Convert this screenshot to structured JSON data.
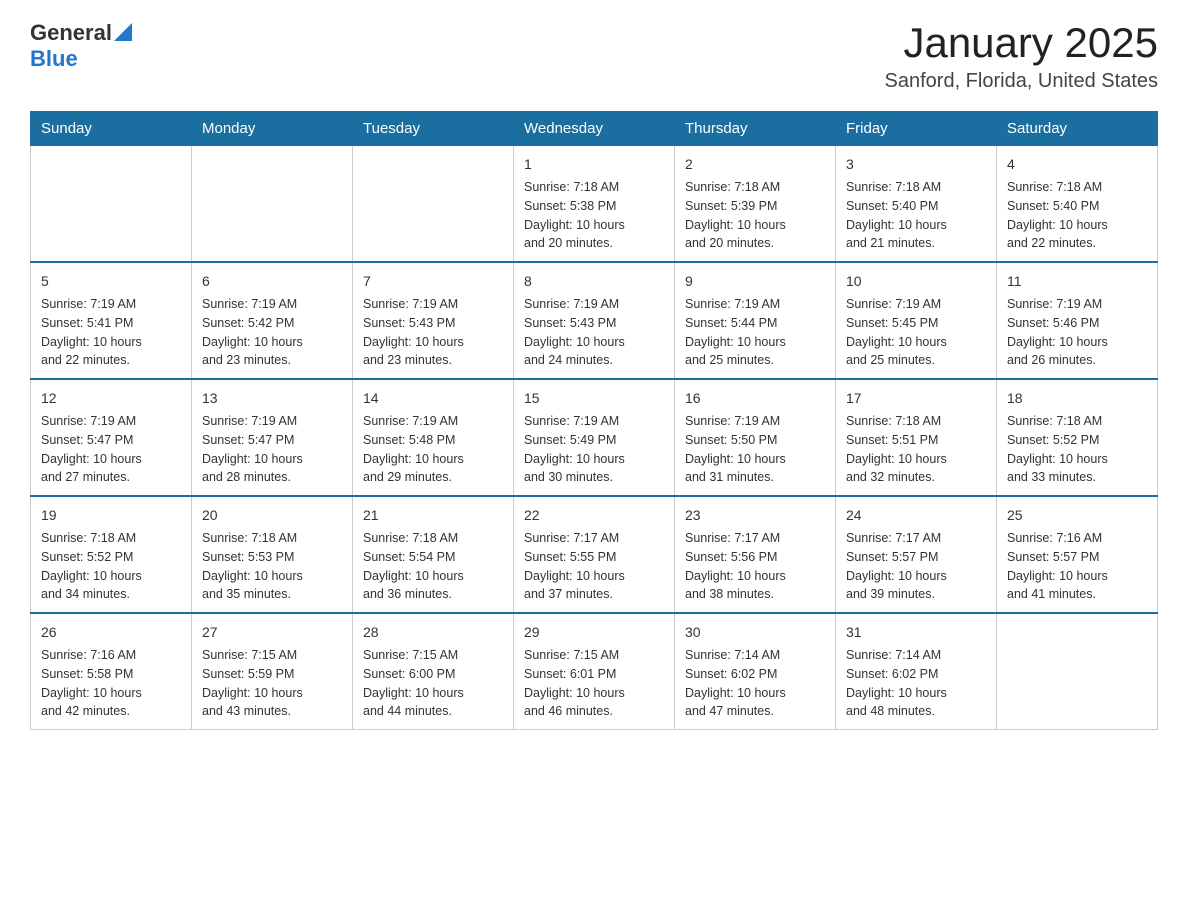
{
  "header": {
    "logo": {
      "general": "General",
      "blue": "Blue"
    },
    "title": "January 2025",
    "location": "Sanford, Florida, United States"
  },
  "calendar": {
    "days_of_week": [
      "Sunday",
      "Monday",
      "Tuesday",
      "Wednesday",
      "Thursday",
      "Friday",
      "Saturday"
    ],
    "weeks": [
      [
        {
          "day": "",
          "info": ""
        },
        {
          "day": "",
          "info": ""
        },
        {
          "day": "",
          "info": ""
        },
        {
          "day": "1",
          "info": "Sunrise: 7:18 AM\nSunset: 5:38 PM\nDaylight: 10 hours\nand 20 minutes."
        },
        {
          "day": "2",
          "info": "Sunrise: 7:18 AM\nSunset: 5:39 PM\nDaylight: 10 hours\nand 20 minutes."
        },
        {
          "day": "3",
          "info": "Sunrise: 7:18 AM\nSunset: 5:40 PM\nDaylight: 10 hours\nand 21 minutes."
        },
        {
          "day": "4",
          "info": "Sunrise: 7:18 AM\nSunset: 5:40 PM\nDaylight: 10 hours\nand 22 minutes."
        }
      ],
      [
        {
          "day": "5",
          "info": "Sunrise: 7:19 AM\nSunset: 5:41 PM\nDaylight: 10 hours\nand 22 minutes."
        },
        {
          "day": "6",
          "info": "Sunrise: 7:19 AM\nSunset: 5:42 PM\nDaylight: 10 hours\nand 23 minutes."
        },
        {
          "day": "7",
          "info": "Sunrise: 7:19 AM\nSunset: 5:43 PM\nDaylight: 10 hours\nand 23 minutes."
        },
        {
          "day": "8",
          "info": "Sunrise: 7:19 AM\nSunset: 5:43 PM\nDaylight: 10 hours\nand 24 minutes."
        },
        {
          "day": "9",
          "info": "Sunrise: 7:19 AM\nSunset: 5:44 PM\nDaylight: 10 hours\nand 25 minutes."
        },
        {
          "day": "10",
          "info": "Sunrise: 7:19 AM\nSunset: 5:45 PM\nDaylight: 10 hours\nand 25 minutes."
        },
        {
          "day": "11",
          "info": "Sunrise: 7:19 AM\nSunset: 5:46 PM\nDaylight: 10 hours\nand 26 minutes."
        }
      ],
      [
        {
          "day": "12",
          "info": "Sunrise: 7:19 AM\nSunset: 5:47 PM\nDaylight: 10 hours\nand 27 minutes."
        },
        {
          "day": "13",
          "info": "Sunrise: 7:19 AM\nSunset: 5:47 PM\nDaylight: 10 hours\nand 28 minutes."
        },
        {
          "day": "14",
          "info": "Sunrise: 7:19 AM\nSunset: 5:48 PM\nDaylight: 10 hours\nand 29 minutes."
        },
        {
          "day": "15",
          "info": "Sunrise: 7:19 AM\nSunset: 5:49 PM\nDaylight: 10 hours\nand 30 minutes."
        },
        {
          "day": "16",
          "info": "Sunrise: 7:19 AM\nSunset: 5:50 PM\nDaylight: 10 hours\nand 31 minutes."
        },
        {
          "day": "17",
          "info": "Sunrise: 7:18 AM\nSunset: 5:51 PM\nDaylight: 10 hours\nand 32 minutes."
        },
        {
          "day": "18",
          "info": "Sunrise: 7:18 AM\nSunset: 5:52 PM\nDaylight: 10 hours\nand 33 minutes."
        }
      ],
      [
        {
          "day": "19",
          "info": "Sunrise: 7:18 AM\nSunset: 5:52 PM\nDaylight: 10 hours\nand 34 minutes."
        },
        {
          "day": "20",
          "info": "Sunrise: 7:18 AM\nSunset: 5:53 PM\nDaylight: 10 hours\nand 35 minutes."
        },
        {
          "day": "21",
          "info": "Sunrise: 7:18 AM\nSunset: 5:54 PM\nDaylight: 10 hours\nand 36 minutes."
        },
        {
          "day": "22",
          "info": "Sunrise: 7:17 AM\nSunset: 5:55 PM\nDaylight: 10 hours\nand 37 minutes."
        },
        {
          "day": "23",
          "info": "Sunrise: 7:17 AM\nSunset: 5:56 PM\nDaylight: 10 hours\nand 38 minutes."
        },
        {
          "day": "24",
          "info": "Sunrise: 7:17 AM\nSunset: 5:57 PM\nDaylight: 10 hours\nand 39 minutes."
        },
        {
          "day": "25",
          "info": "Sunrise: 7:16 AM\nSunset: 5:57 PM\nDaylight: 10 hours\nand 41 minutes."
        }
      ],
      [
        {
          "day": "26",
          "info": "Sunrise: 7:16 AM\nSunset: 5:58 PM\nDaylight: 10 hours\nand 42 minutes."
        },
        {
          "day": "27",
          "info": "Sunrise: 7:15 AM\nSunset: 5:59 PM\nDaylight: 10 hours\nand 43 minutes."
        },
        {
          "day": "28",
          "info": "Sunrise: 7:15 AM\nSunset: 6:00 PM\nDaylight: 10 hours\nand 44 minutes."
        },
        {
          "day": "29",
          "info": "Sunrise: 7:15 AM\nSunset: 6:01 PM\nDaylight: 10 hours\nand 46 minutes."
        },
        {
          "day": "30",
          "info": "Sunrise: 7:14 AM\nSunset: 6:02 PM\nDaylight: 10 hours\nand 47 minutes."
        },
        {
          "day": "31",
          "info": "Sunrise: 7:14 AM\nSunset: 6:02 PM\nDaylight: 10 hours\nand 48 minutes."
        },
        {
          "day": "",
          "info": ""
        }
      ]
    ]
  }
}
